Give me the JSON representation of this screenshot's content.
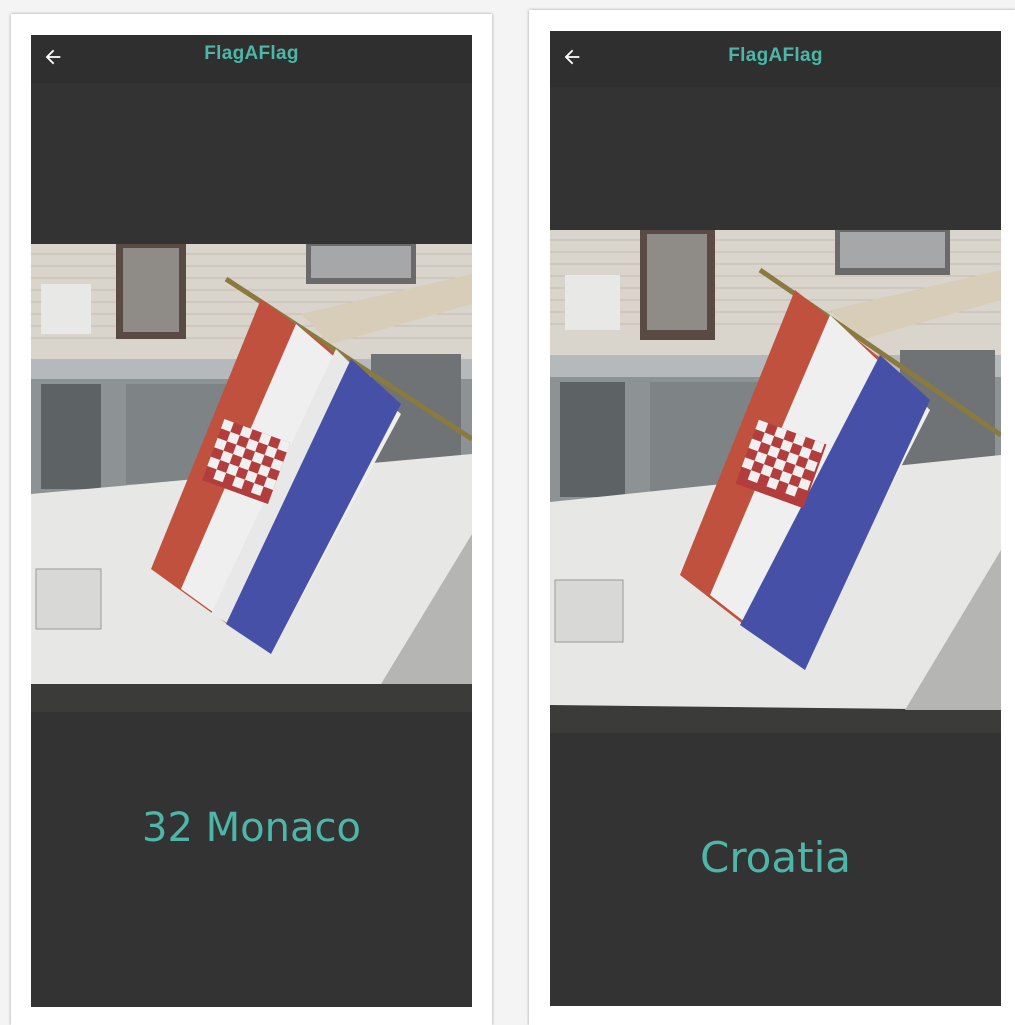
{
  "screens": [
    {
      "app_title": "FlagAFlag",
      "result_text": "32 Monaco",
      "back_icon": "arrow-left-icon"
    },
    {
      "app_title": "FlagAFlag",
      "result_text": "Croatia",
      "back_icon": "arrow-left-icon"
    }
  ],
  "colors": {
    "accent": "#4db6a8",
    "background": "#333333",
    "appbar": "#2f2f2f"
  }
}
